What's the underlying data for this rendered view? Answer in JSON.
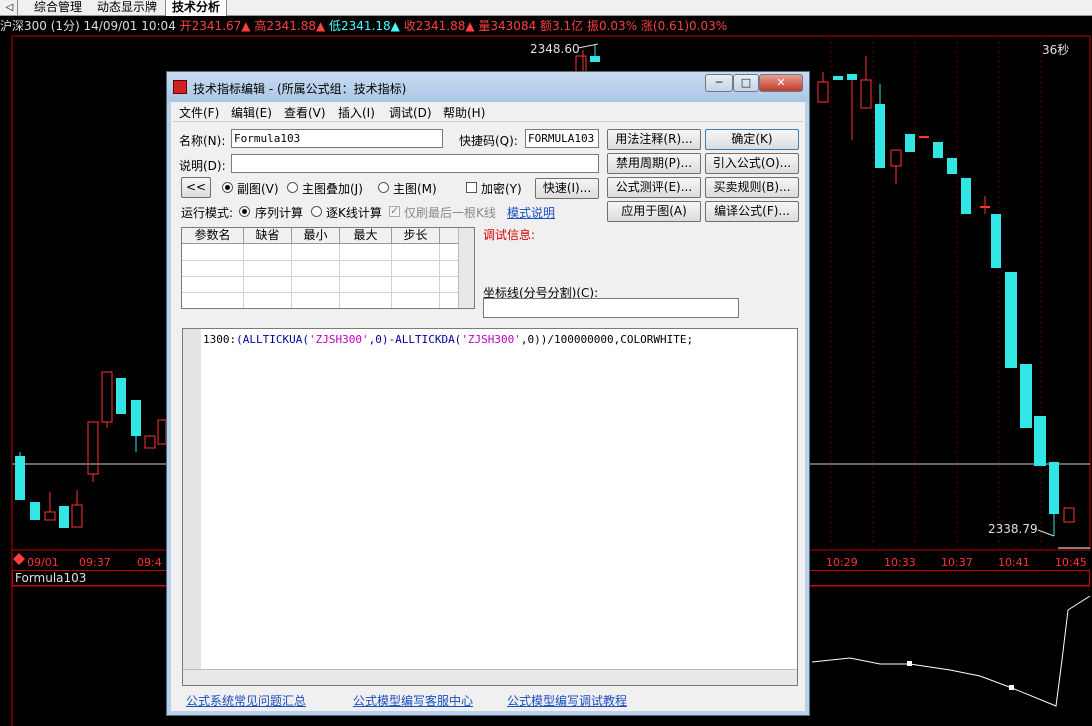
{
  "tabs": {
    "nav_glyph": "◁",
    "items": [
      {
        "label": "综合管理"
      },
      {
        "label": "动态显示牌"
      },
      {
        "label": "技术分析"
      }
    ]
  },
  "info": {
    "symbol": "沪深300 (1分) 14/09/01 10:04",
    "open": "开2341.67▲",
    "high": "高2341.88▲",
    "low": "低2341.18▲",
    "close": "收2341.88▲",
    "volume": "量343084",
    "amount": "额3.1亿",
    "amplitude": "振0.03%",
    "change": "涨(0.61)0.03%"
  },
  "chart_labels": {
    "high_marker": "2348.60",
    "low_marker": "2338.79",
    "countdown": "36秒",
    "formula_bar": "Formula103",
    "time_axis": [
      "09/01",
      "09:37",
      "09:4",
      "10:29",
      "10:33",
      "10:37",
      "10:41",
      "10:45"
    ]
  },
  "colors": {
    "up": "#ff3333",
    "down": "#33e6e6",
    "axis_red": "#ff2020",
    "dialog_bg": "#f0f0f0"
  },
  "dialog": {
    "title": "技术指标编辑 - (所属公式组：技术指标)",
    "window_buttons": {
      "minimize": "─",
      "maximize": "□",
      "close": "✕"
    },
    "menu": [
      "文件(F)",
      "编辑(E)",
      "查看(V)",
      "插入(I)",
      "调试(D)",
      "帮助(H)"
    ],
    "name_label": "名称(N):",
    "name_value": "Formula103",
    "shortcut_label": "快捷码(Q):",
    "shortcut_value": "FORMULA103",
    "desc_label": "说明(D):",
    "desc_value": "",
    "collapse_button": "<<",
    "display": {
      "sub_chart": "副图(V)",
      "main_overlay": "主图叠加(J)",
      "main_chart": "主图(M)",
      "encrypt": "加密(Y)",
      "quick": "快速(I)..."
    },
    "run_mode_label": "运行模式:",
    "run_modes": {
      "sequential": "序列计算",
      "per_bar": "逐K线计算",
      "last_only": "仅刷最后一根K线"
    },
    "mode_help_link": "模式说明",
    "buttons_left": [
      "用法注释(R)...",
      "禁用周期(P)...",
      "公式测评(E)...",
      "应用于图(A)"
    ],
    "buttons_right": [
      "确定(K)",
      "引入公式(O)...",
      "买卖规则(B)...",
      "编译公式(F)..."
    ],
    "param_headers": [
      "参数名",
      "缺省",
      "最小",
      "最大",
      "步长"
    ],
    "debug_label": "调试信息:",
    "axis_label": "坐标线(分号分割)(C):",
    "axis_value": "",
    "code": {
      "p1": "1300:",
      "p2": "(ALLTICKUA(",
      "p3": "'ZJSH300'",
      "p4": ",0)-ALLTICKDA(",
      "p5": "'ZJSH300'",
      "p6": ",0))/100000000,COLORWHITE;"
    },
    "footer_links": [
      "公式系统常见问题汇总",
      "公式模型编写客服中心",
      "公式模型编写调试教程"
    ]
  }
}
